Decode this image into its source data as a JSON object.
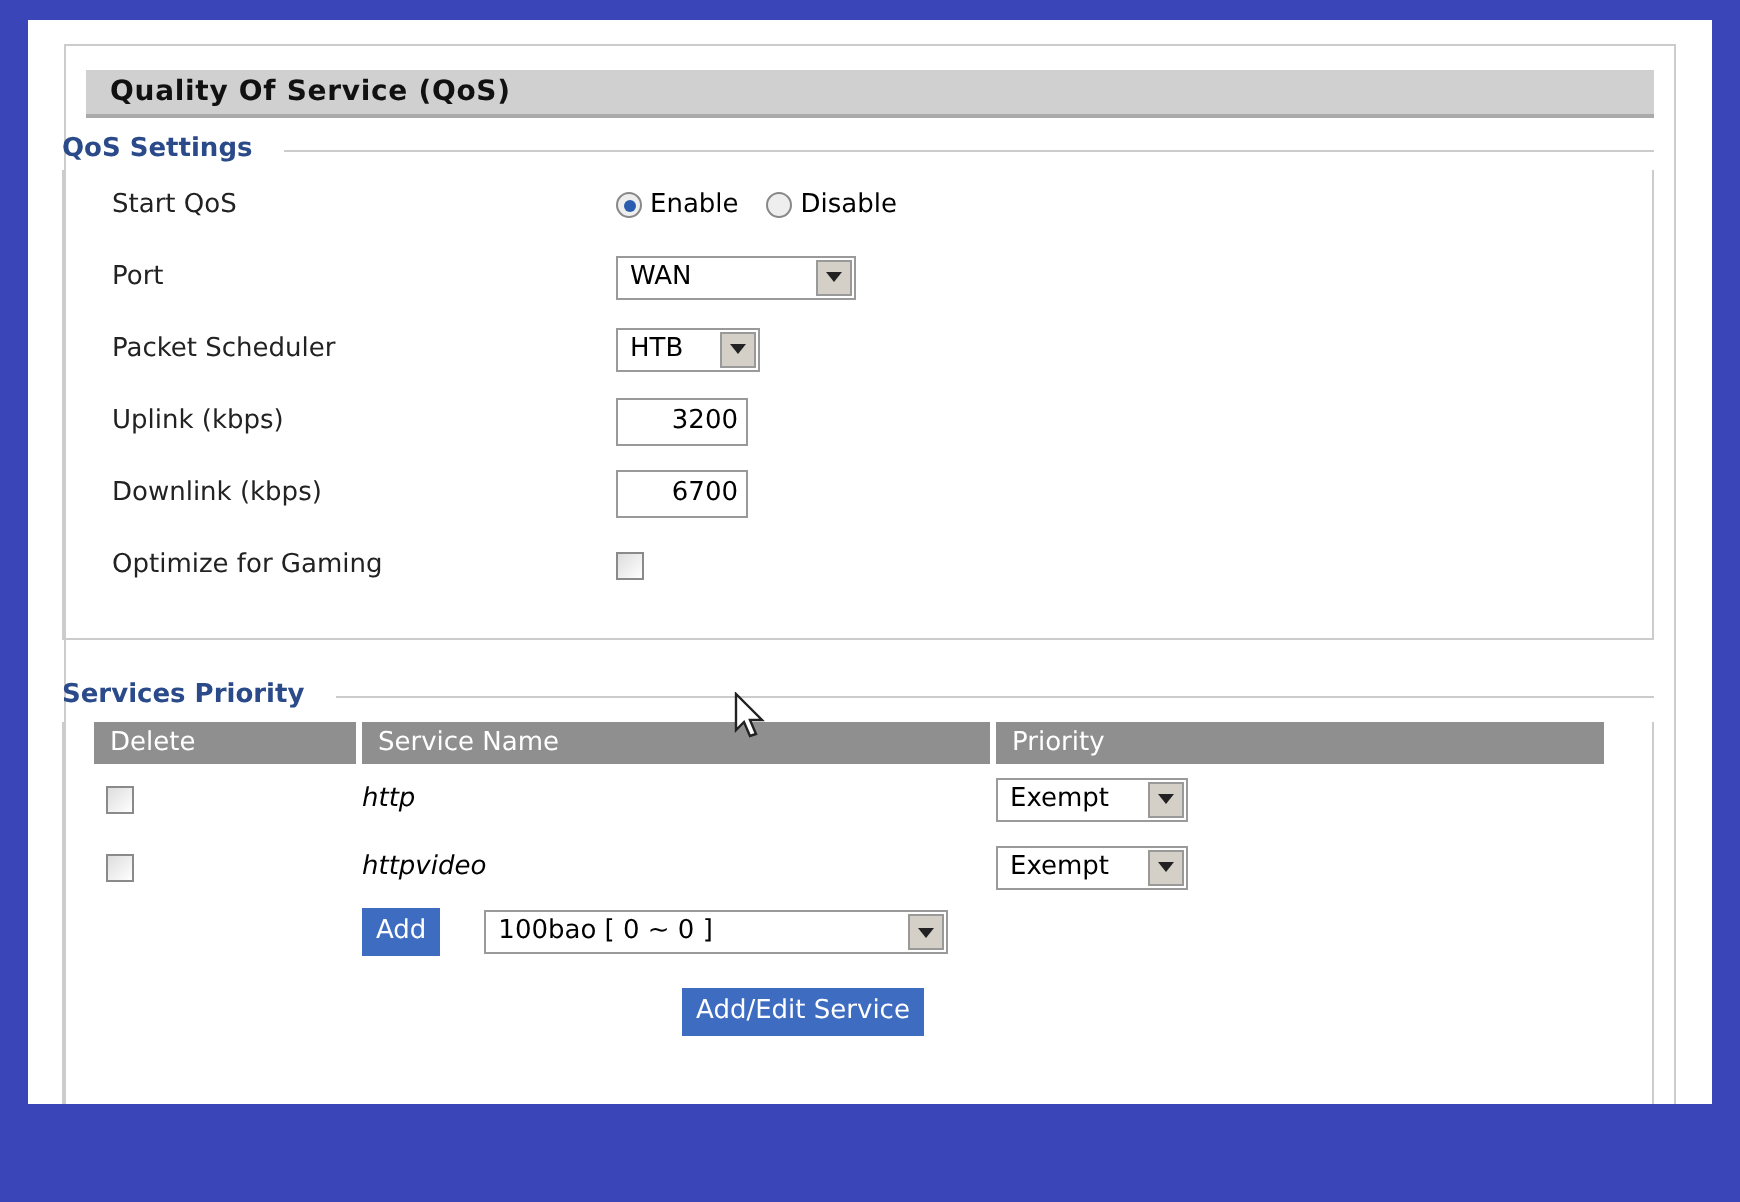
{
  "header": {
    "title": "Quality Of Service (QoS)"
  },
  "qos_settings": {
    "legend": "QoS Settings",
    "start_qos": {
      "label": "Start QoS",
      "options": [
        {
          "label": "Enable",
          "selected": true
        },
        {
          "label": "Disable",
          "selected": false
        }
      ]
    },
    "port": {
      "label": "Port",
      "value": "WAN"
    },
    "packet_scheduler": {
      "label": "Packet Scheduler",
      "value": "HTB"
    },
    "uplink": {
      "label": "Uplink (kbps)",
      "value": "3200"
    },
    "downlink": {
      "label": "Downlink (kbps)",
      "value": "6700"
    },
    "optimize_gaming": {
      "label": "Optimize for Gaming",
      "checked": false
    }
  },
  "services_priority": {
    "legend": "Services Priority",
    "columns": [
      "Delete",
      "Service Name",
      "Priority"
    ],
    "rows": [
      {
        "checked": false,
        "service": "http",
        "priority": "Exempt"
      },
      {
        "checked": false,
        "service": "httpvideo",
        "priority": "Exempt"
      }
    ],
    "add_button": "Add",
    "add_select": "100bao [ 0 ~ 0 ]",
    "edit_button": "Add/Edit Service"
  }
}
